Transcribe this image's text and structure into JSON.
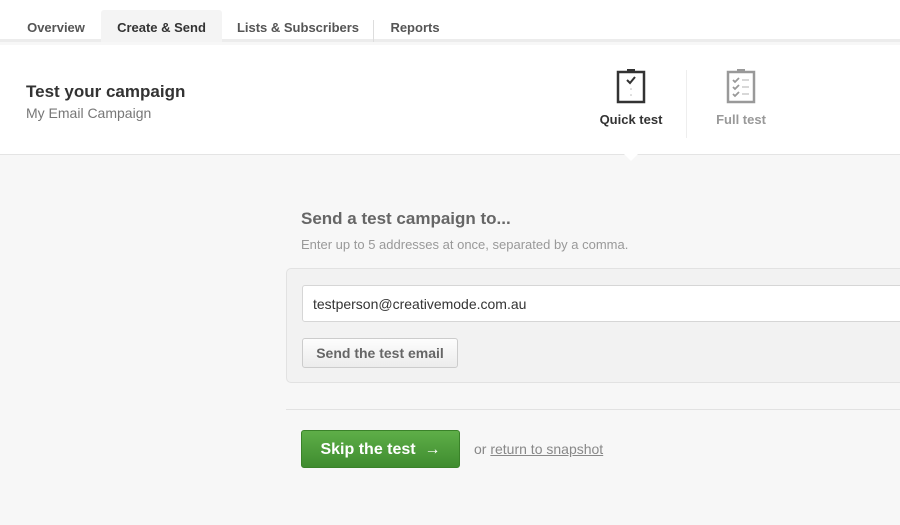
{
  "nav": {
    "tabs": [
      {
        "label": "Overview"
      },
      {
        "label": "Create & Send",
        "active": true
      },
      {
        "label": "Lists & Subscribers"
      },
      {
        "label": "Reports"
      }
    ]
  },
  "header": {
    "title": "Test your campaign",
    "subtitle": "My Email Campaign",
    "modes": [
      {
        "label": "Quick test",
        "icon": "clipboard-check-icon",
        "selected": true
      },
      {
        "label": "Full test",
        "icon": "clipboard-checklist-icon",
        "selected": false
      }
    ]
  },
  "form": {
    "heading": "Send a test campaign to...",
    "hint": "Enter up to 5 addresses at once, separated by a comma.",
    "email_value": "testperson@creativemode.com.au",
    "send_label": "Send the test email"
  },
  "footer": {
    "skip_label": "Skip the test",
    "skip_arrow": "→",
    "or_text": "or",
    "return_link": "return to snapshot"
  },
  "colors": {
    "accent_green": "#4a9c37"
  }
}
